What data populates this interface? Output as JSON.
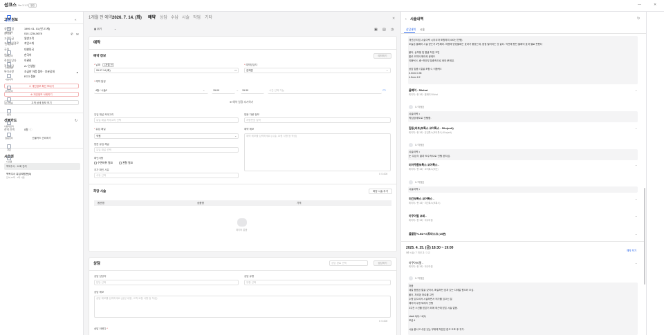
{
  "app": {
    "brand": "성코스",
    "version": "Ver.3.1.2",
    "badge": "일반"
  },
  "left": {
    "customer_title": "고객 정보",
    "customer_rows": [
      {
        "k": "생년월일",
        "v": "1999. 01. 01 (만 27세)"
      },
      {
        "k": "연락처",
        "v": "010-1234-5678"
      },
      {
        "k": "고객등급",
        "v": "일반고객"
      },
      {
        "k": "고객유입경로",
        "v": "지인소개"
      },
      {
        "k": "국적",
        "v": "대한민국"
      },
      {
        "k": "언어",
        "v": "한국어"
      },
      {
        "k": "직원담당자",
        "v": "이관린"
      },
      {
        "k": "직원상담",
        "v": "A / 인생살"
      },
      {
        "k": "특이사항",
        "v": "조금만 아픔 참아 · 부분공개"
      }
    ],
    "note_extra": "ECG 정본",
    "pink_btn_1": "개인정보 확인 보내기",
    "pink_btn_2": "개인정보 삭제하기",
    "detail_btn": "고객 상세 정보 보기",
    "card_title": "선불카드",
    "card_rows": [
      {
        "k": "전액 잔액",
        "v": "0원"
      }
    ],
    "card_btn": "선불카드 관리하기",
    "treat_title": "시술권",
    "treat_item_label": "백옥주사 - 10회 잔여",
    "treat_item_name": "백옥주사 유입/재방문(5)",
    "treat_item_sub": "잔여 10회 · 1회 사용"
  },
  "mid": {
    "header_prefix": "1개월 전 예약",
    "header_date": "2026. 7. 14. (화)",
    "tabs": [
      "예약",
      "상담",
      "수납",
      "시술",
      "작업",
      "기타"
    ],
    "view_select": "위기",
    "reserve_section": "예약",
    "reserve_info": "예약 정보",
    "save_label": "예약하기",
    "date_label": "날짜",
    "date_hint": "1개월 전",
    "date_value": "26.07.14 (화)",
    "staff_label": "예약담당자",
    "staff_value": "김재운",
    "time_label": "예약 일정",
    "time_select": "4층 / 시술2",
    "time_from": "15:00",
    "time_to": "15:30",
    "time_ph": "시간 선택 가능",
    "time_link": "예약 일정 추가하기",
    "rsv_type_label": "유입 채널 카테고리",
    "rsv_type_ph": "유입 채널 카테고리 선택",
    "cust_label": "방문 차량 정보",
    "cust_ph": "차량번호 입력",
    "treat_type_label": "유입 채널",
    "treat_type_value": "직원",
    "memo_label": "예약 메모",
    "memo_ph": "예약 메모를 입력하세요 (시술, 요청 사항 등 작성)",
    "bed_label": "방문 유입 채널",
    "bed_ph": "유입 채널 선택",
    "prep_label": "확인사항",
    "prep_opt1": "수면마취 필요",
    "prep_opt2": "관찰 필요",
    "rec_label": "추가 확인 사유",
    "rec_ph": "사유 선택",
    "counter": "0 / 1000",
    "hope_title": "희망 시술",
    "hope_add": "희망 시술 추가",
    "col1": "옵션명",
    "col2": "상품명",
    "col3": "가격",
    "empty": "데이터 없음",
    "consult_title": "상담",
    "consult_ph": "상담 완료 선택",
    "consult_save": "상담하기",
    "c_staff_label": "상담 담당자",
    "c_staff_ph": "담당 선택",
    "c_type_label": "상담 유형",
    "c_type_ph": "유형 선택",
    "c_memo_label": "상담 메모",
    "c_memo_ph": "상담 메모를 입력하세요 (상담 내용, 고객 요청 사항 등 작성)",
    "c_counter": "0 / 1000",
    "c_next_label": "상담 아젠다"
  },
  "right": {
    "title": "시술내역",
    "tab1": "상담내역",
    "tab2": "시술",
    "memo_lines": [
      "개선된 타임 시술이력 • (아쿠아 포함하여 400신 진행)",
      "오늘은 올페어 시술 받는거 4번째다. 처음에 받았을때는 효과가 좋았는데, 점점 떨어지는 것 같다. 직전에 했던 올페어 효과 별로 못봤다",
      "",
      "볼어, 상부용 및 얼굴 처짐 고민",
      "팔로 오피어 해야되 문제도",
      "이중턱 X, 중~하단부 집중적으로 써야 문제임.",
      "",
      "상담 집중 / 얼굴 포함 0, 이중턱X",
      "3.0mm 0.35",
      "4.5mm 1/2"
    ],
    "items": [
      {
        "name": "올페어 - 50shot",
        "sub": "레이저 / 총 1회 · 올페어 50shot"
      },
      {
        "name": "힘동(리프)보톡스 코어톡스 - 50u(unit)",
        "sub": "레이저 / 총 1회 · 유입톡스(코어톡스) 50u(unit)"
      },
      {
        "name": "미아주름보톡스 코어톡스 -",
        "sub": "레이저 / 총 1회 · 코어톡스(미간)"
      },
      {
        "name": "미간보톡스 코어톡스 -",
        "sub": "레이저 / 총 1회 · 미간톡스(보톡스)"
      },
      {
        "name": "아쿠아필 코레 -",
        "sub": "레이저 / 총 1회 · 아쿠아필"
      },
      {
        "name": "올블랑+LED+시트마스크 (15분)",
        "sub": ""
      }
    ],
    "sub_notes": [
      {
        "who": "0 / 차정호",
        "text": "시술이력 •",
        "text2": "약임장세도로 진행함."
      },
      {
        "who": "0 / 차정호",
        "text": "시술이력 •",
        "text2": "눈 주입각 결과 보수적으로 진행 완치심."
      },
      {
        "who": "0 / 차정호",
        "text": "시술이력 •",
        "text2": ""
      }
    ],
    "visit_date": "2025. 4. 25. (금) 18:30 ~ 19:00",
    "visit_sub": "5층 시술 / 7 개선 교 / 3 교",
    "visit_link": "예약 보기",
    "visit_item": "아쿠아리필 -",
    "visit_item_sub": "레이저 / 총 1회 · 아쿠아필",
    "visit_who": "0 / 차정호",
    "visit_memo": [
      "처음",
      "네일 증표된 얼굴 있어서, 확실하던 효과 있는 디테일 원으러 오심.",
      "볼이, 처리된 마르를 고민",
      "수명 있으셔서 시술하면서 허가를 있으신 분",
      "레이져 수명 되레서 진행",
      "3주전 스킨를 받은거 외에 최근에 받은 시술 없음.",
      "",
      "stack 5(5) +4(5)",
      "모공 4",
      "",
      "시술 끝나고 수분 있는 부위에 작은은 한고 도포 후 귀가."
    ]
  },
  "sidebar": [
    {
      "label": "예약추가",
      "icon": "plus-icon"
    },
    {
      "label": "예약관리",
      "icon": "calendar-icon"
    },
    {
      "label": "고객관리",
      "icon": "user-icon"
    },
    {
      "label": "시술관리",
      "icon": "treatment-icon"
    },
    {
      "label": "수납현황",
      "icon": "payment-icon"
    },
    {
      "label": "시술내역",
      "icon": "history-icon"
    },
    {
      "label": "상담관리",
      "icon": "chat-icon"
    },
    {
      "label": "문자발송",
      "icon": "message-icon"
    },
    {
      "label": "통계",
      "icon": "chart-icon"
    },
    {
      "label": "사용자관리",
      "icon": "users-icon"
    },
    {
      "label": "알림센터",
      "icon": "bell-icon"
    },
    {
      "label": "자료",
      "icon": "file-icon"
    },
    {
      "label": "시스템",
      "icon": "settings-icon"
    }
  ]
}
